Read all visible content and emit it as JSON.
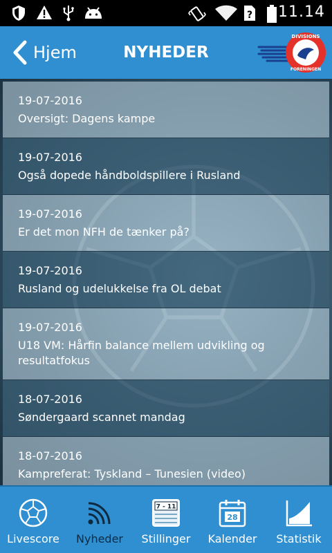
{
  "status_bar": {
    "time": "11.14",
    "icons": [
      "shield-icon",
      "warning-icon",
      "usb-icon",
      "android-icon",
      "vibrate-icon",
      "wifi-icon",
      "sim-unknown-icon",
      "battery-icon"
    ]
  },
  "header": {
    "back_label": "Hjem",
    "title": "NYHEDER",
    "logo_text_top": "DIVISIONS",
    "logo_text_bottom": "FORENINGEN"
  },
  "news": [
    {
      "date": "19-07-2016",
      "title": "Oversigt: Dagens kampe"
    },
    {
      "date": "19-07-2016",
      "title": "Også dopede håndboldspillere i Rusland"
    },
    {
      "date": "19-07-2016",
      "title": "Er det mon NFH de tænker på?"
    },
    {
      "date": "19-07-2016",
      "title": "Rusland og udelukkelse fra OL debat"
    },
    {
      "date": "19-07-2016",
      "title": "U18 VM: Hårfin balance mellem udvikling og resultatfokus"
    },
    {
      "date": "18-07-2016",
      "title": "Søndergaard scannet mandag"
    },
    {
      "date": "18-07-2016",
      "title": "Kampreferat: Tyskland – Tunesien (video)"
    }
  ],
  "tabs": [
    {
      "label": "Livescore",
      "icon": "ball-icon"
    },
    {
      "label": "Nyheder",
      "icon": "rss-icon",
      "active": true
    },
    {
      "label": "Stillinger",
      "icon": "standings-icon",
      "icon_text": "7 - 11"
    },
    {
      "label": "Kalender",
      "icon": "calendar-icon",
      "icon_text": "28"
    },
    {
      "label": "Statistik",
      "icon": "chart-icon"
    }
  ],
  "colors": {
    "header": "#2f8fd0",
    "tabbar": "#2f8fd0",
    "active_tab": "#0e2a40"
  }
}
